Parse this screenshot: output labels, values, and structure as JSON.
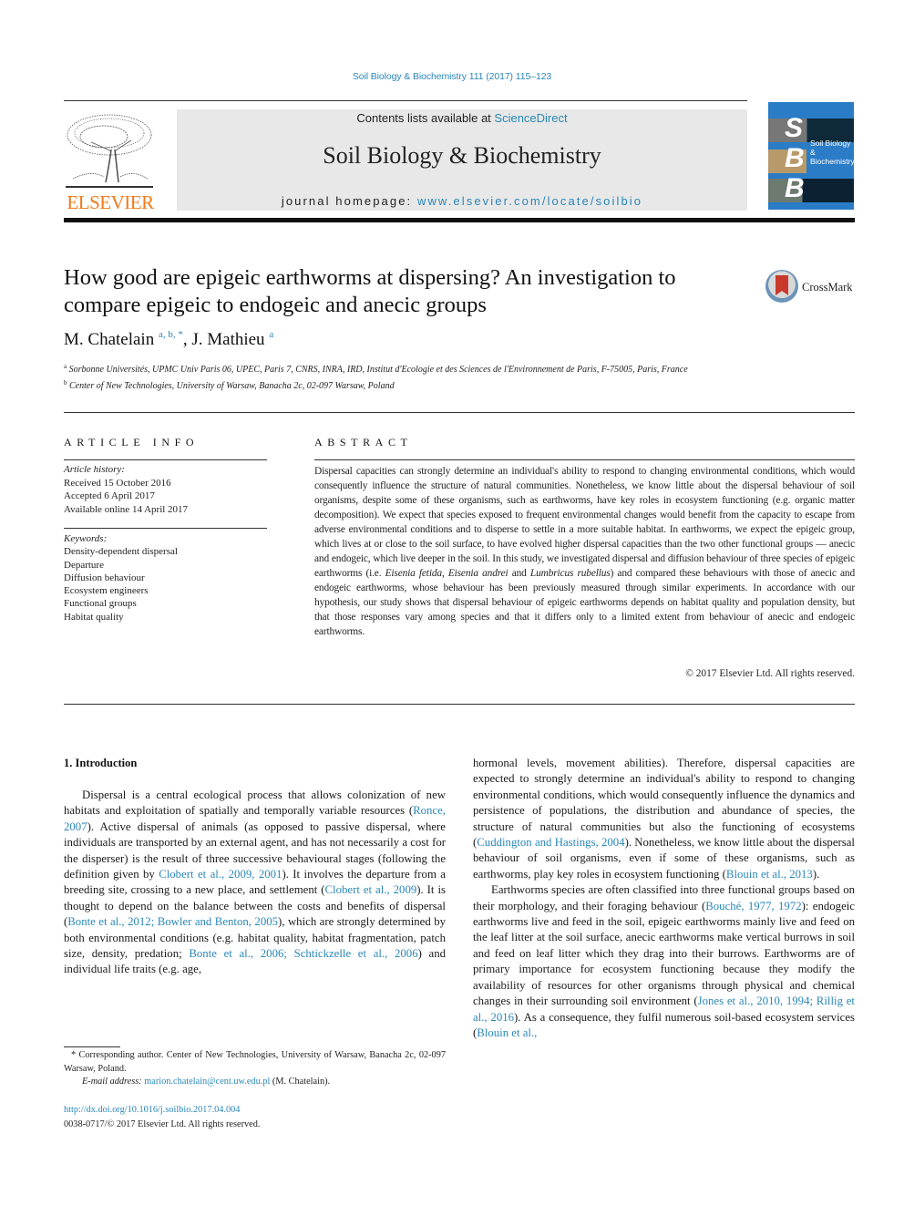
{
  "header": {
    "journal_ref": "Soil Biology & Biochemistry 111 (2017) 115–123",
    "publisher": "ELSEVIER",
    "contents_prefix": "Contents lists available at ",
    "contents_link": "ScienceDirect",
    "journal_name": "Soil Biology & Biochemistry",
    "homepage_prefix": "journal homepage: ",
    "homepage_link": "www.elsevier.com/locate/soilbio",
    "cover": {
      "letters": [
        "S",
        "B",
        "B"
      ],
      "title_line1": "Soil Biology &",
      "title_line2": "Biochemistry",
      "color": "#2a7cc7"
    }
  },
  "article": {
    "title": "How good are epigeic earthworms at dispersing? An investigation to compare epigeic to endogeic and anecic groups",
    "crossmark_label": "CrossMark",
    "authors": [
      {
        "name": "M. Chatelain",
        "marks": "a, b, *"
      },
      {
        "name": "J. Mathieu",
        "marks": "a"
      }
    ],
    "affiliations": [
      {
        "mark": "a",
        "text": "Sorbonne Universités, UPMC Univ Paris 06, UPEC, Paris 7, CNRS, INRA, IRD, Institut d'Ecologie et des Sciences de l'Environnement de Paris, F-75005, Paris, France"
      },
      {
        "mark": "b",
        "text": "Center of New Technologies, University of Warsaw, Banacha 2c, 02-097 Warsaw, Poland"
      }
    ]
  },
  "article_info": {
    "heading": "ARTICLE INFO",
    "history_label": "Article history:",
    "history": [
      "Received 15 October 2016",
      "Accepted 6 April 2017",
      "Available online 14 April 2017"
    ],
    "keywords_label": "Keywords:",
    "keywords": [
      "Density-dependent dispersal",
      "Departure",
      "Diffusion behaviour",
      "Ecosystem engineers",
      "Functional groups",
      "Habitat quality"
    ]
  },
  "abstract": {
    "heading": "ABSTRACT",
    "part1": "Dispersal capacities can strongly determine an individual's ability to respond to changing environmental conditions, which would consequently influence the structure of natural communities. Nonetheless, we know little about the dispersal behaviour of soil organisms, despite some of these organisms, such as earthworms, have key roles in ecosystem functioning (e.g. organic matter decomposition). We expect that species exposed to frequent environmental changes would benefit from the capacity to escape from adverse environmental conditions and to disperse to settle in a more suitable habitat. In earthworms, we expect the epigeic group, which lives at or close to the soil surface, to have evolved higher dispersal capacities than the two other functional groups — anecic and endogeic, which live deeper in the soil. In this study, we investigated dispersal and diffusion behaviour of three species of epigeic earthworms (i.e. ",
    "species1": "Eisenia fetida",
    "sep1": ", ",
    "species2": "Eisenia andrei",
    "sep2": " and ",
    "species3": "Lumbricus rubellus",
    "part2": ") and compared these behaviours with those of anecic and endogeic earthworms, whose behaviour has been previously measured through similar experiments. In accordance with our hypothesis, our study shows that dispersal behaviour of epigeic earthworms depends on habitat quality and population density, but that those responses vary among species and that it differs only to a limited extent from behaviour of anecic and endogeic earthworms.",
    "copyright": "© 2017 Elsevier Ltd. All rights reserved."
  },
  "body": {
    "section_heading": "1.  Introduction",
    "left": {
      "t1": "Dispersal is a central ecological process that allows colonization of new habitats and exploitation of spatially and temporally variable resources (",
      "c1": "Ronce, 2007",
      "t2": "). Active dispersal of animals (as opposed to passive dispersal, where individuals are transported by an external agent, and has not necessarily a cost for the disperser) is the result of three successive behavioural stages (following the definition given by ",
      "c2": "Clobert et al., 2009, 2001",
      "t3": "). It involves the departure from a breeding site, crossing to a new place, and settlement (",
      "c3": "Clobert et al., 2009",
      "t4": "). It is thought to depend on the balance between the costs and benefits of dispersal (",
      "c4": "Bonte et al., 2012; Bowler and Benton, 2005",
      "t5": "), which are strongly determined by both environmental conditions (e.g. habitat quality, habitat fragmentation, patch size, density, predation; ",
      "c5": "Bonte et al., 2006; Schtickzelle et al., 2006",
      "t6": ") and individual life traits (e.g. age,"
    },
    "right": {
      "t1": "hormonal levels, movement abilities). Therefore, dispersal capacities are expected to strongly determine an individual's ability to respond to changing environmental conditions, which would consequently influence the dynamics and persistence of populations, the distribution and abundance of species, the structure of natural communities but also the functioning of ecosystems (",
      "c1": "Cuddington and Hastings, 2004",
      "t2": "). Nonetheless, we know little about the dispersal behaviour of soil organisms, even if some of these organisms, such as earthworms, play key roles in ecosystem functioning (",
      "c2": "Blouin et al., 2013",
      "t3": ").",
      "p2_t1": "Earthworms species are often classified into three functional groups based on their morphology, and their foraging behaviour (",
      "p2_c1": "Bouché, 1977, 1972",
      "p2_t2": "): endogeic earthworms live and feed in the soil, epigeic earthworms mainly live and feed on the leaf litter at the soil surface, anecic earthworms make vertical burrows in soil and feed on leaf litter which they drag into their burrows. Earthworms are of primary importance for ecosystem functioning because they modify the availability of resources for other organisms through physical and chemical changes in their surrounding soil environment (",
      "p2_c2": "Jones et al., 2010, 1994; Rillig et al., 2016",
      "p2_t3": "). As a consequence, they fulfil numerous soil-based ecosystem services (",
      "p2_c3": "Blouin et al.,"
    }
  },
  "footnote": {
    "corresponding": "* Corresponding author. Center of New Technologies, University of Warsaw, Banacha 2c, 02-097 Warsaw, Poland.",
    "email_label": "E-mail address: ",
    "email": "marion.chatelain@cent.uw.edu.pl",
    "email_suffix": " (M. Chatelain).",
    "doi": "http://dx.doi.org/10.1016/j.soilbio.2017.04.004",
    "issn": "0038-0717/© 2017 Elsevier Ltd. All rights reserved."
  },
  "colors": {
    "link": "#2a87b8",
    "elsevier_orange": "#f07a1a",
    "banner_bg": "#e8e8e8",
    "crossmark_red": "#c9392b"
  }
}
